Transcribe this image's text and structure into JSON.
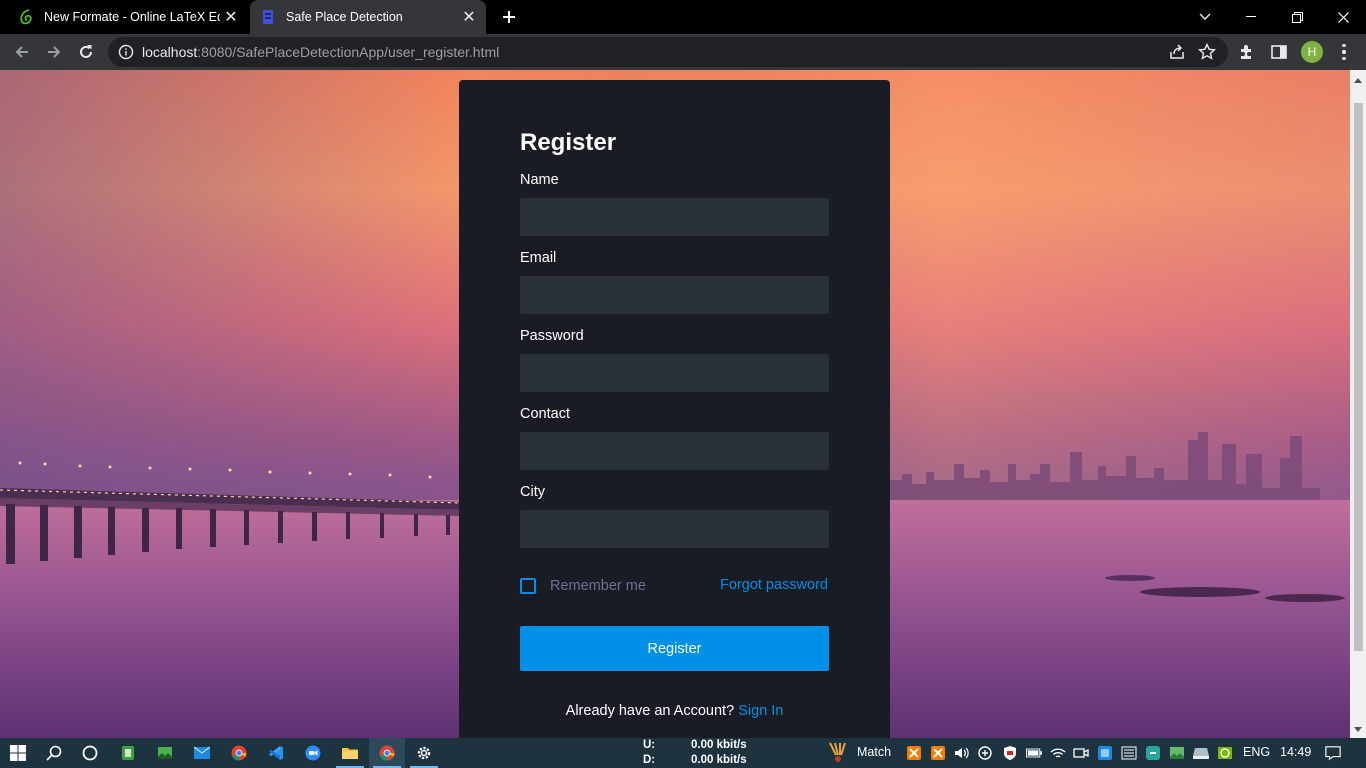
{
  "browser": {
    "tabs": [
      {
        "title": "New Formate - Online LaTeX Edit",
        "active": false,
        "favicon": "overleaf-leaf-icon"
      },
      {
        "title": "Safe Place Detection",
        "active": true,
        "favicon": "page-icon"
      }
    ],
    "url": {
      "host": "localhost",
      "rest": ":8080/SafePlaceDetectionApp/user_register.html"
    },
    "profile_initial": "H"
  },
  "form": {
    "heading": "Register",
    "fields": [
      {
        "label": "Name",
        "value": ""
      },
      {
        "label": "Email",
        "value": ""
      },
      {
        "label": "Password",
        "value": ""
      },
      {
        "label": "Contact",
        "value": ""
      },
      {
        "label": "City",
        "value": ""
      }
    ],
    "remember_label": "Remember me",
    "remember_checked": false,
    "forgot_label": "Forgot password",
    "submit_label": "Register",
    "account_prompt": "Already have an Account?",
    "signin_label": "Sign In"
  },
  "taskbar": {
    "net_up_label": "U:",
    "net_up_value": "0.00 kbit/s",
    "net_down_label": "D:",
    "net_down_value": "0.00 kbit/s",
    "weather_label": "Match",
    "language": "ENG",
    "time": "14:49"
  },
  "colors": {
    "card_bg": "#191c24",
    "input_bg": "#2a3038",
    "accent": "#0090e7",
    "muted_text": "#6c7293",
    "taskbar_bg": "#1d3340"
  }
}
